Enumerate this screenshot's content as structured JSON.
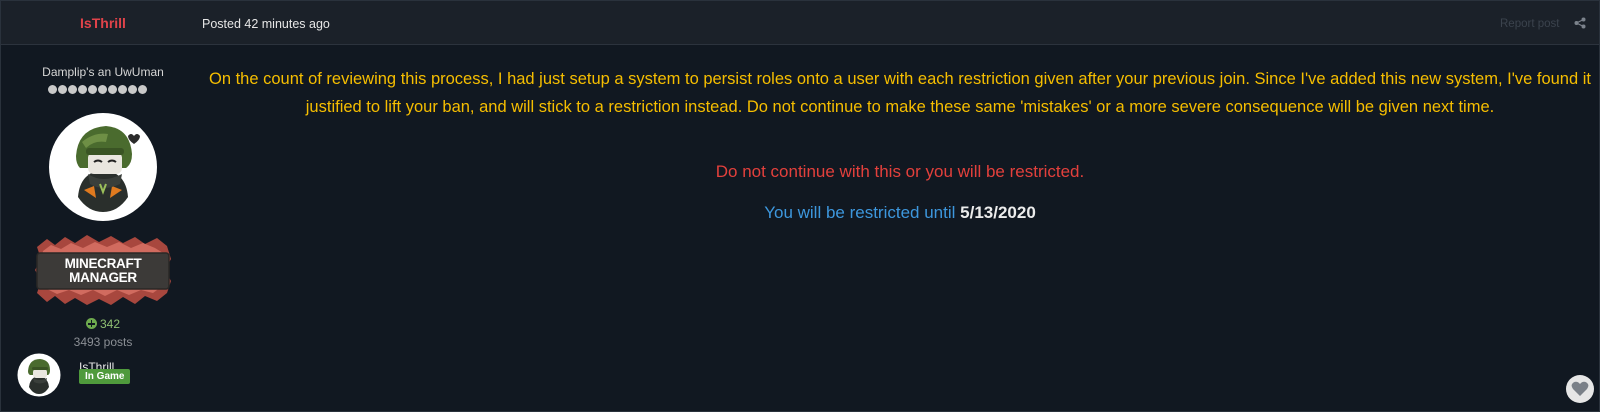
{
  "header": {
    "author": "IsThrill",
    "posted": "Posted 42 minutes ago",
    "report_label": "Report post",
    "share_icon": "share-icon"
  },
  "sidebar": {
    "user_title": "Damplip's an UwUman",
    "pip_count": 10,
    "rank_badge": {
      "line1": "MINECRAFT",
      "line2": "MANAGER"
    },
    "reputation": "342",
    "post_count": "3493 posts",
    "presence": {
      "name": "IsThrill",
      "status": "In Game"
    }
  },
  "content": {
    "paragraph": "On the count of reviewing this process, I had just setup a system to persist roles onto a user with each restriction given after your previous join. Since I've added this new system, I've found it justified to lift your ban, and will stick to a restriction instead. Do not continue to make these same 'mistakes' or a more severe consequence will be given next time.",
    "warning": "Do not continue with this or you will be restricted.",
    "restriction_prefix": "You will be restricted until ",
    "restriction_date": "5/13/2020"
  },
  "colors": {
    "background": "#111821",
    "header": "#1b2129",
    "author": "#e0434a",
    "yellow_text": "#f6be00",
    "red_text": "#e3403c",
    "blue_text": "#3d97dd",
    "status_green": "#4f9a3c"
  },
  "icons": {
    "like": "heart-icon",
    "reputation": "plus-circle-icon"
  }
}
